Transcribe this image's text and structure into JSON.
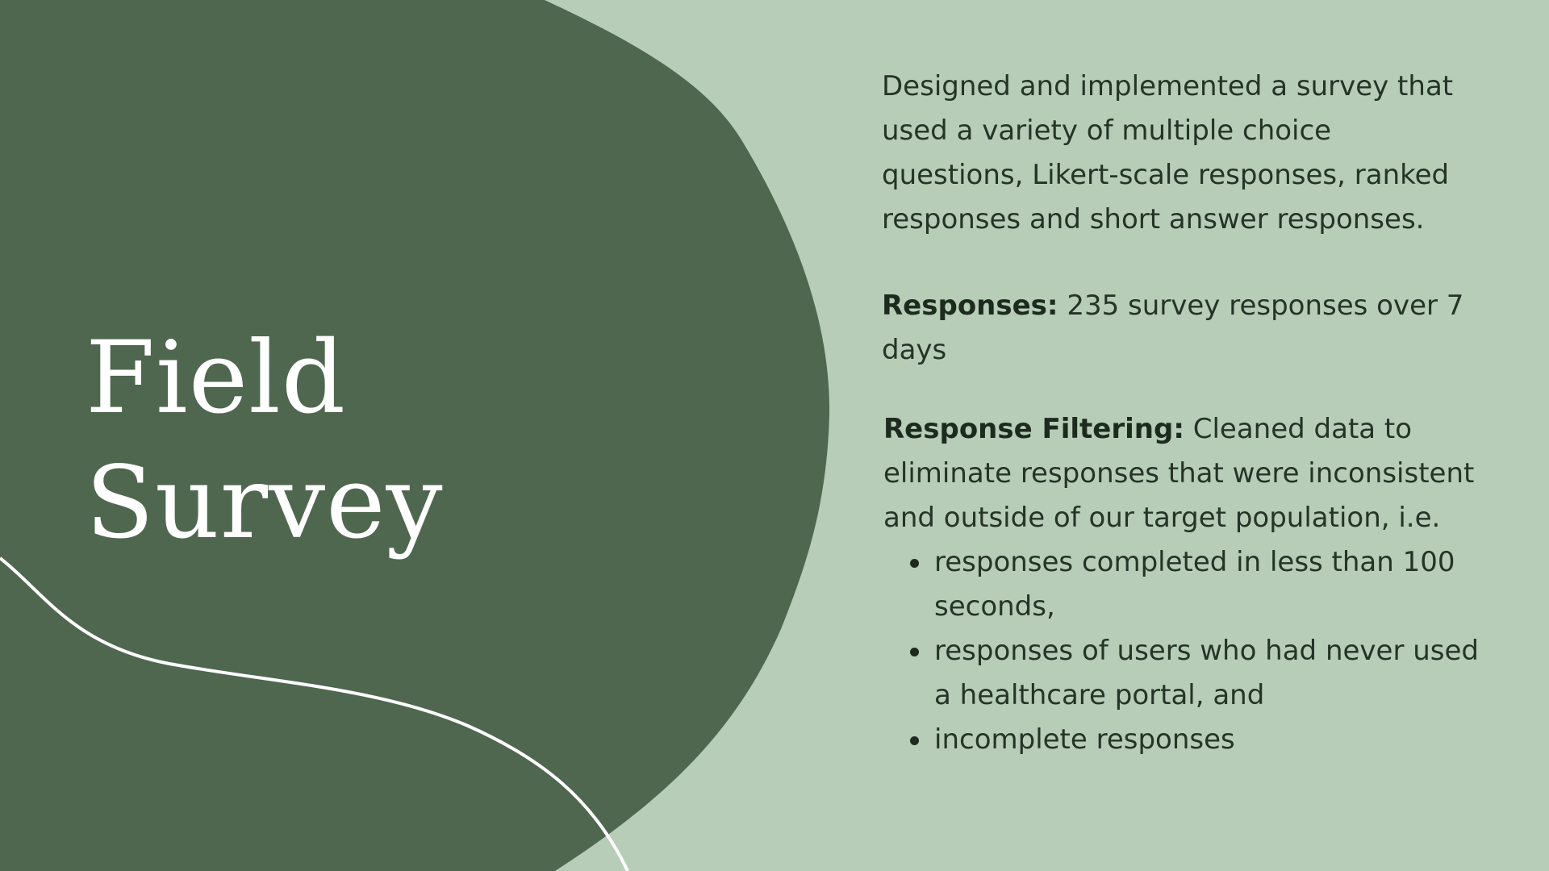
{
  "colors": {
    "background": "#b7cdb8",
    "blob": "#4f674f",
    "title_text": "#ffffff",
    "body_text": "#253426",
    "line": "#ffffff"
  },
  "title": {
    "line1": "Field",
    "line2": "Survey"
  },
  "intro": "Designed and implemented a survey that used a variety of multiple choice questions, Likert-scale responses, ranked responses and short answer responses.",
  "responses": {
    "label": "Responses:",
    "text": " 235 survey responses over 7 days"
  },
  "filtering": {
    "label": "Response Filtering:",
    "text": " Cleaned data to eliminate responses that were inconsistent and outside of our target population, i.e.",
    "bullets": [
      "responses completed in less than 100 seconds,",
      "responses of users who had never used a healthcare portal, and",
      "incomplete responses"
    ]
  }
}
